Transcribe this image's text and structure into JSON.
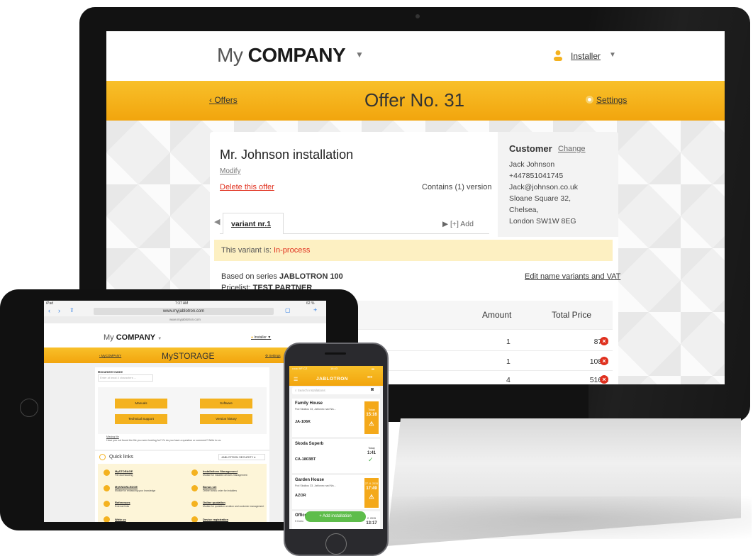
{
  "desktop": {
    "logo_light": "My",
    "logo_bold": "COMPANY",
    "user": "Installer",
    "back_link": "Offers",
    "page_title": "Offer No. 31",
    "settings": "Settings",
    "offer_name": "Mr. Johnson installation",
    "modify": "Modify",
    "delete": "Delete this offer",
    "contains": "Contains (1) version",
    "customer": {
      "title": "Customer",
      "change": "Change",
      "lines": [
        "Jack Johnson",
        "+447851041745",
        "Jack@johnson.co.uk",
        "Sloane Square 32,",
        "Chelsea,",
        "London SW1W 8EG"
      ]
    },
    "tab_label": "variant nr.1",
    "tab_add": "[+] Add",
    "status_prefix": "This variant is: ",
    "status_value": "In-process",
    "series_prefix": "Based on series ",
    "series_value": "JABLOTRON 100",
    "pricelist_prefix": "Pricelist: ",
    "pricelist_value": "TEST PARTNER",
    "edit_vat": "Edit name variants and VAT",
    "table": {
      "headers": [
        "Amount",
        "Total Price"
      ],
      "rows": [
        {
          "amount": "1",
          "price": "87 €"
        },
        {
          "amount": "1",
          "price": "108 €"
        },
        {
          "amount": "4",
          "price": "516 €"
        }
      ]
    }
  },
  "tablet": {
    "status_left": "iPad",
    "status_time": "7:37 AM",
    "status_right": "62 %",
    "url": "www.myjablotron.com",
    "sub_url": "www.myjablotron.com",
    "logo_light": "My",
    "logo_bold": "COMPANY",
    "user": "Installer",
    "back_link": "MyCOMPANY",
    "title": "MySTORAGE",
    "settings": "Settings",
    "doc_name_label": "Document name",
    "doc_placeholder": "Enter at least 4 characters ...",
    "buttons": [
      "Manuals",
      "Software",
      "Technical Support",
      "Version history"
    ],
    "missing_title": "Missing file",
    "missing_text": "Have you not found the file you were looking for? Or do you have a question or comment? Write to us.",
    "quick_links": "Quick links",
    "select_value": "JABLOTRON SECURITY",
    "links": [
      {
        "title": "MySTORAGE",
        "sub": "File downloading"
      },
      {
        "title": "Installations Management",
        "sub": "Module for installed devices management"
      },
      {
        "title": "MyKNOWLEDGE",
        "sub": "Module for enhancing your knowledge"
      },
      {
        "title": "Bonus set",
        "sub": "Online bonus order for installers"
      },
      {
        "title": "References",
        "sub": "External links"
      },
      {
        "title": "Online quotation",
        "sub": "Module for quotation creation and customer management"
      },
      {
        "title": "Write us",
        "sub": ""
      },
      {
        "title": "Device registration",
        "sub": ""
      }
    ]
  },
  "phone": {
    "status_carrier": "•••oo VF CZ",
    "status_time": "16:43",
    "title": "JABLOTRON",
    "search_placeholder": "Search installations",
    "cards": [
      {
        "name": "Family House",
        "addr": "Pod Skalkou 33, Jablonec nad Nis...",
        "code": "JA-106K",
        "side_label": "Today",
        "side_time": "15:16",
        "side_type": "alert"
      },
      {
        "name": "Skoda Superb",
        "addr": "",
        "code": "CA-1803BT",
        "side_label": "Today",
        "side_time": "1:41",
        "side_type": "ok"
      },
      {
        "name": "Garden House",
        "addr": "Pod Skalkou 33, Jablonec nad Nis...",
        "code": "AZOR",
        "side_label": "27. 6. 2015",
        "side_time": "17:49",
        "side_type": "alert"
      },
      {
        "name": "Office",
        "addr": "K Dubu",
        "code": "",
        "side_label": "2. 2015",
        "side_time": "13:17",
        "side_type": "plain"
      }
    ],
    "add_button": "+ Add installation"
  }
}
